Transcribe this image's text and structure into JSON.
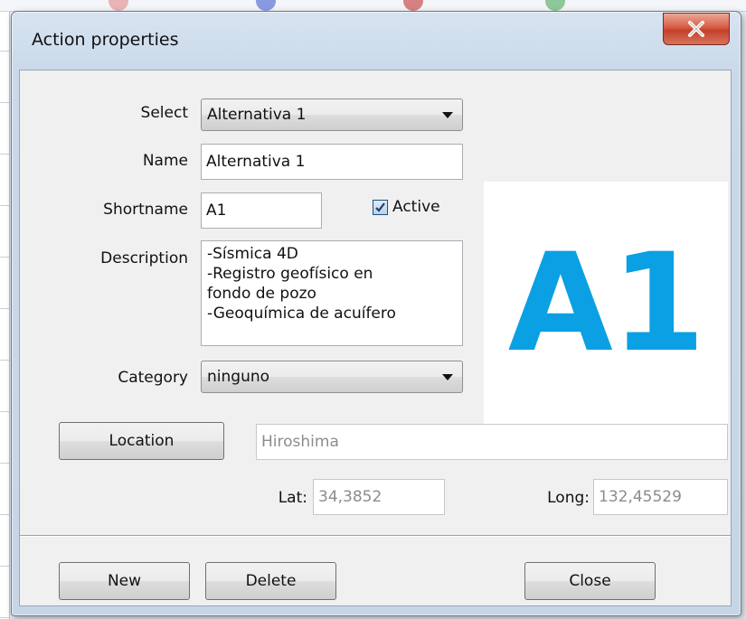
{
  "window": {
    "title": "Action properties"
  },
  "form": {
    "select_label": "Select",
    "select_value": "Alternativa 1",
    "name_label": "Name",
    "name_value": "Alternativa 1",
    "shortname_label": "Shortname",
    "shortname_value": "A1",
    "active_label": "Active",
    "active_checked": true,
    "description_label": "Description",
    "description_lines": [
      "-Sísmica 4D",
      "-Registro geofísico en",
      "fondo de pozo",
      "-Geoquímica de acuífero"
    ],
    "category_label": "Category",
    "category_value": "ninguno"
  },
  "preview": {
    "text": "A1",
    "color": "#0aa0e3"
  },
  "location": {
    "button_label": "Location",
    "place_value": "Hiroshima",
    "lat_label": "Lat:",
    "lat_value": "34,3852",
    "long_label": "Long:",
    "long_value": "132,45529"
  },
  "buttons": {
    "new": "New",
    "delete": "Delete",
    "close": "Close"
  },
  "icons": {
    "close": "close-icon",
    "dropdown": "chevron-down-icon",
    "check": "checkmark-icon"
  }
}
